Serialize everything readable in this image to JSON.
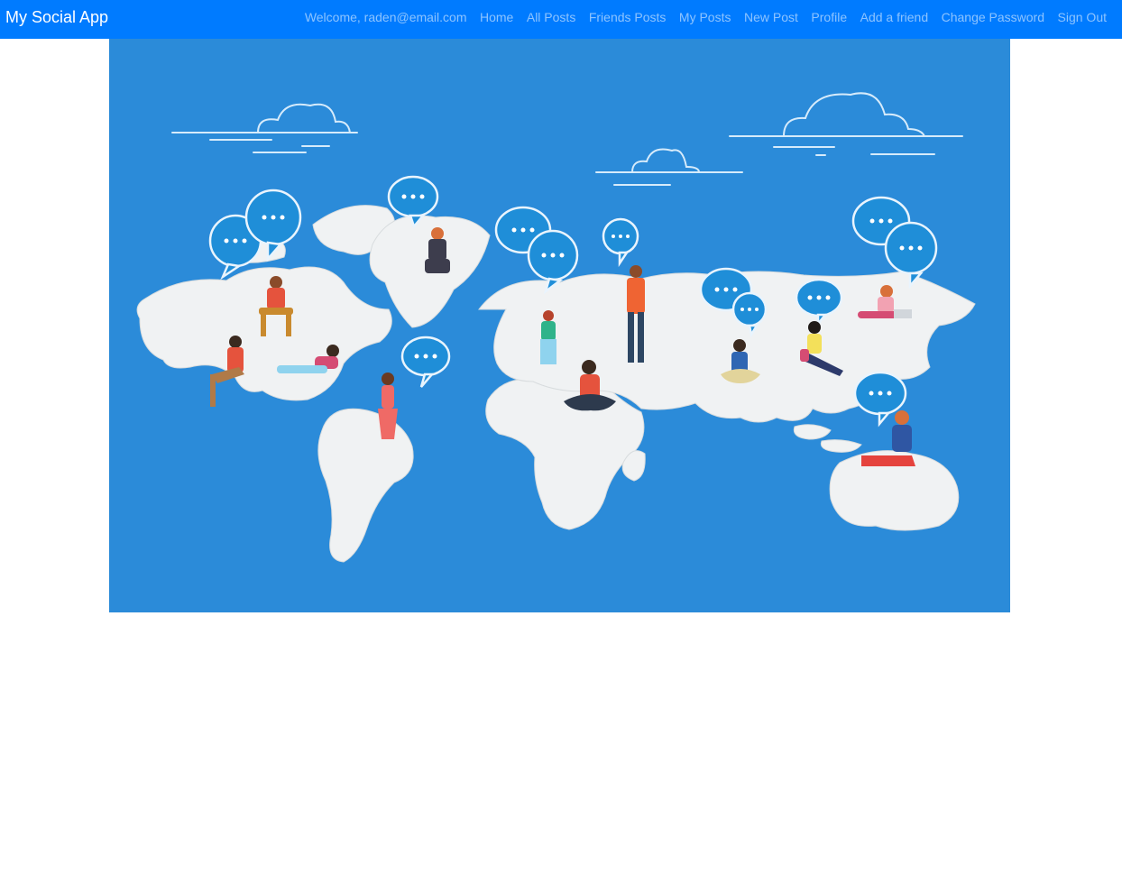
{
  "navbar": {
    "brand": "My Social App",
    "welcome": "Welcome, raden@email.com",
    "links": [
      "Home",
      "All Posts",
      "Friends Posts",
      "My Posts",
      "New Post",
      "Profile",
      "Add a friend",
      "Change Password",
      "Sign Out"
    ]
  },
  "colors": {
    "navbar_bg": "#007bff",
    "hero_bg": "#2b8bd9",
    "map_land": "#f0f2f3",
    "bubble": "#1f8ed8"
  },
  "hero": {
    "image": "world-map-people-chatting-illustration"
  }
}
